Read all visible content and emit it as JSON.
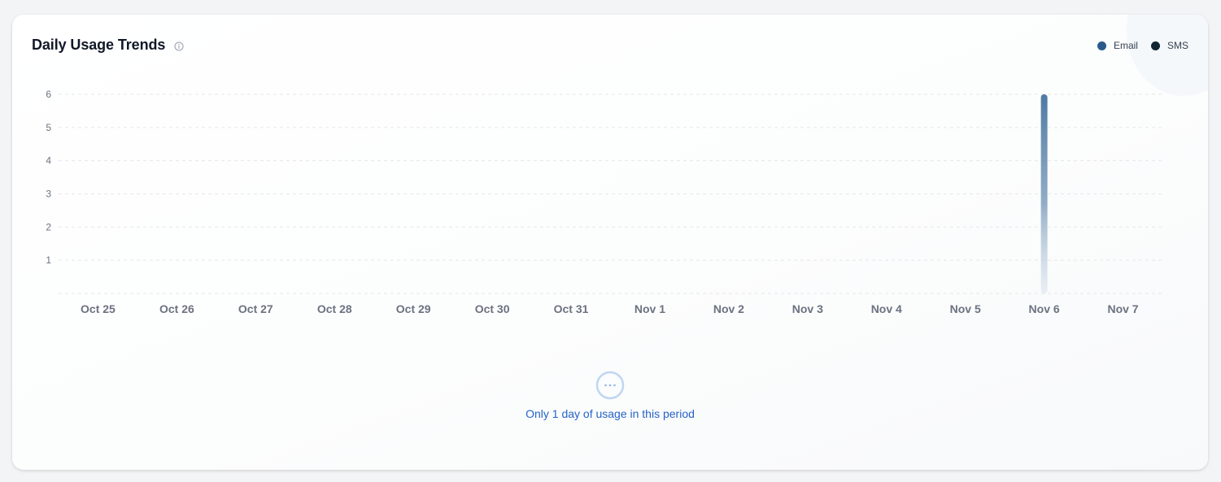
{
  "card": {
    "title": "Daily Usage Trends",
    "info_icon": "info-circle-icon",
    "note_icon": "ellipsis-circle-icon",
    "note_text": "Only 1 day of usage in this period"
  },
  "colors": {
    "email": "#2a5a8c",
    "sms": "#0f2530",
    "grid": "#e5e7eb",
    "note": "#2563c9"
  },
  "chart_data": {
    "type": "bar",
    "categories": [
      "Oct 25",
      "Oct 26",
      "Oct 27",
      "Oct 28",
      "Oct 29",
      "Oct 30",
      "Oct 31",
      "Nov 1",
      "Nov 2",
      "Nov 3",
      "Nov 4",
      "Nov 5",
      "Nov 6",
      "Nov 7"
    ],
    "series": [
      {
        "name": "Email",
        "values": [
          0,
          0,
          0,
          0,
          0,
          0,
          0,
          0,
          0,
          0,
          0,
          0,
          6,
          0
        ]
      },
      {
        "name": "SMS",
        "values": [
          0,
          0,
          0,
          0,
          0,
          0,
          0,
          0,
          0,
          0,
          0,
          0,
          0,
          0
        ]
      }
    ],
    "yticks": [
      1,
      2,
      3,
      4,
      5,
      6
    ],
    "ylim": [
      0,
      6
    ],
    "grid": true,
    "legend": "top-right",
    "title": "",
    "xlabel": "",
    "ylabel": ""
  }
}
